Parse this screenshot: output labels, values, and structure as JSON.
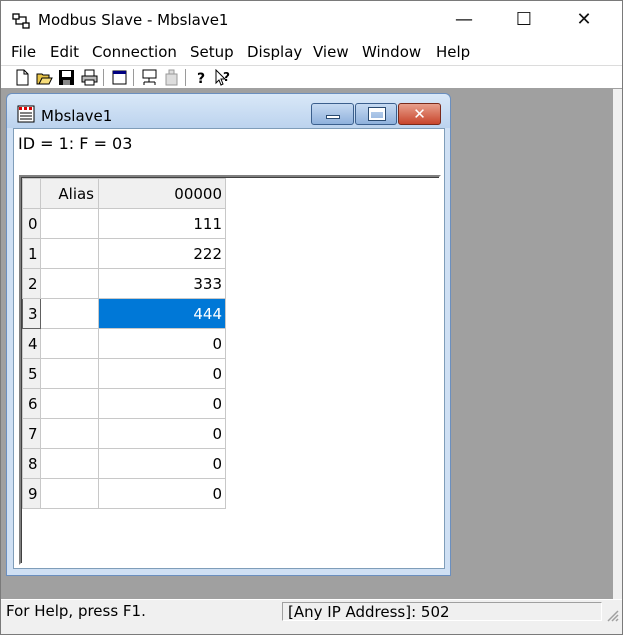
{
  "app": {
    "title": "Modbus Slave - Mbslave1",
    "window_controls": {
      "minimize": "—",
      "maximize": "☐",
      "close": "✕"
    }
  },
  "menu": [
    "File",
    "Edit",
    "Connection",
    "Setup",
    "Display",
    "View",
    "Window",
    "Help"
  ],
  "toolbar": [
    "new-icon",
    "open-icon",
    "save-icon",
    "print-icon",
    "window-icon",
    "connect-icon",
    "disconnect-icon",
    "help-icon",
    "context-help-icon"
  ],
  "child": {
    "title": "Mbslave1",
    "id_line": "ID = 1: F = 03",
    "controls": {
      "close": "✕"
    }
  },
  "grid": {
    "headers": {
      "alias": "Alias",
      "column": "00000"
    },
    "selected_row": 3,
    "rows": [
      {
        "index": "0",
        "alias": "",
        "value": "111"
      },
      {
        "index": "1",
        "alias": "",
        "value": "222"
      },
      {
        "index": "2",
        "alias": "",
        "value": "333"
      },
      {
        "index": "3",
        "alias": "",
        "value": "444"
      },
      {
        "index": "4",
        "alias": "",
        "value": "0"
      },
      {
        "index": "5",
        "alias": "",
        "value": "0"
      },
      {
        "index": "6",
        "alias": "",
        "value": "0"
      },
      {
        "index": "7",
        "alias": "",
        "value": "0"
      },
      {
        "index": "8",
        "alias": "",
        "value": "0"
      },
      {
        "index": "9",
        "alias": "",
        "value": "0"
      }
    ]
  },
  "status": {
    "help": "For Help, press F1.",
    "address": "[Any IP Address]: 502"
  },
  "colors": {
    "selection": "#0078d7",
    "mdi_background": "#a0a0a0",
    "close_button": "#c8452c"
  }
}
